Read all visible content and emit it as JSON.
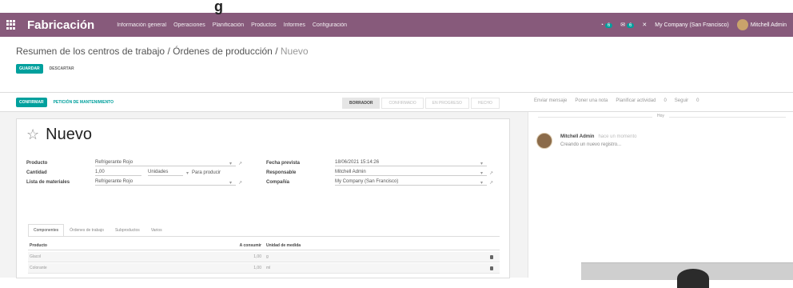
{
  "titlebar": {
    "partial_text": "g"
  },
  "navbar": {
    "brand": "Fabricación",
    "menu": [
      "Información general",
      "Operaciones",
      "Planificación",
      "Productos",
      "Informes",
      "Configuración"
    ],
    "activity_badge": "6",
    "messages_badge": "6",
    "company": "My Company (San Francisco)",
    "user": "Mitchell Admin"
  },
  "control_panel": {
    "breadcrumb_link": "Resumen de los centros de trabajo / Órdenes de producción",
    "breadcrumb_sep": " / ",
    "breadcrumb_current": "Nuevo",
    "save_label": "GUARDAR",
    "discard_label": "DESCARTAR"
  },
  "status_bar": {
    "confirm_label": "CONFIRMAR",
    "maintenance_label": "PETICIÓN DE MANTENIMIENTO",
    "stages": [
      "BORRADOR",
      "CONFIRMADO",
      "EN PROGRESO",
      "HECHO"
    ],
    "chatter_actions": [
      "Enviar mensaje",
      "Poner una nota",
      "Planificar actividad",
      "0",
      "Seguir",
      "0"
    ]
  },
  "form": {
    "title": "Nuevo",
    "producto_label": "Producto",
    "producto_value": "Refrigerante Rojo",
    "cantidad_label": "Cantidad",
    "cantidad_value": "1,00",
    "unidades_value": "Unidades",
    "para_producir": "Para producir",
    "lista_label": "Lista de materiales",
    "lista_value": "Refrigerante Rojo",
    "fecha_label": "Fecha prevista",
    "fecha_value": "18/06/2021 15:14:26",
    "responsable_label": "Responsable",
    "responsable_value": "Mitchell Admin",
    "compania_label": "Compañía",
    "compania_value": "My Company (San Francisco)"
  },
  "tabs": [
    "Componentes",
    "Órdenes de trabajo",
    "Subproductos",
    "Varios"
  ],
  "table": {
    "headers": [
      "Producto",
      "A consumir",
      "Unidad de medida"
    ],
    "rows": [
      {
        "producto": "Glacol",
        "consumir": "1,00",
        "unidad": "g"
      },
      {
        "producto": "Colorante",
        "consumir": "1,00",
        "unidad": "ml"
      }
    ]
  },
  "chatter": {
    "today_label": "Hoy",
    "author": "Mitchell Admin",
    "time": "hace un momento",
    "body": "Creando un nuevo registro..."
  }
}
